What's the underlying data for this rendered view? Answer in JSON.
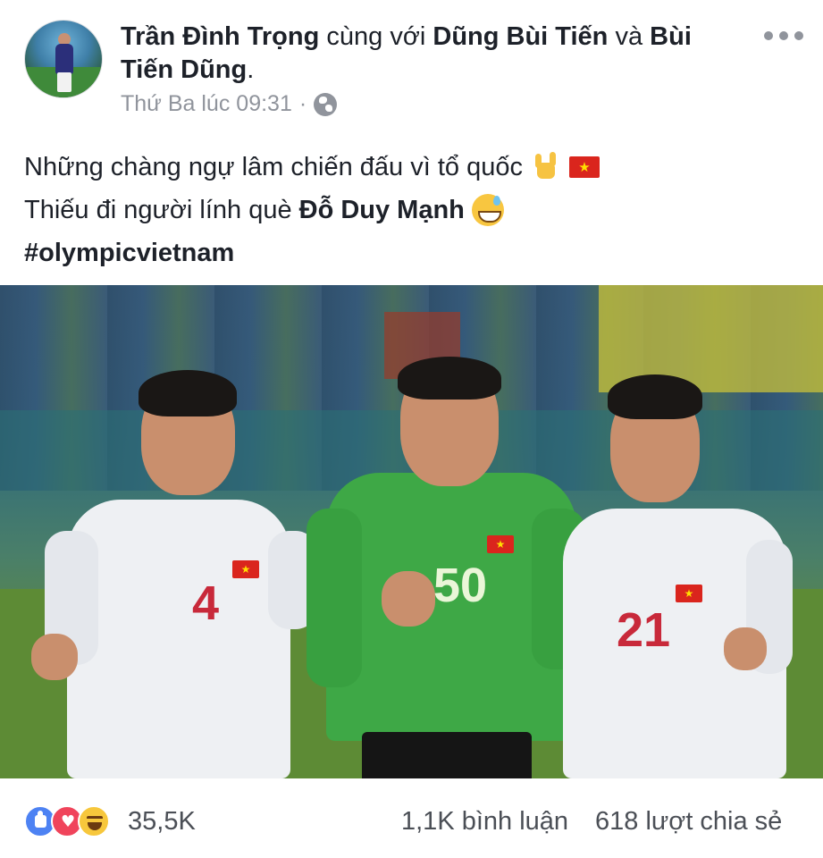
{
  "post": {
    "author": "Trần Đình Trọng",
    "with_text": "cùng với",
    "tagged_1": "Dũng Bùi Tiến",
    "and_text": "và",
    "tagged_2_line1": "Bùi",
    "tagged_2_line2": "Tiến Dũng",
    "period": ".",
    "timestamp": "Thứ Ba lúc 09:31",
    "separator": "·",
    "privacy_icon": "globe-icon",
    "more_icon": "more-options-icon"
  },
  "content": {
    "line1": "Những chàng ngự lâm chiến đấu vì tổ quốc",
    "line2_prefix": "Thiếu đi người lính què",
    "line2_bold": "Đỗ Duy Mạnh",
    "hashtag": "#olympicvietnam",
    "emoji_1": "rock-hand-emoji",
    "emoji_2": "vietnam-flag-emoji",
    "emoji_3": "grinning-sweat-emoji"
  },
  "photo": {
    "description_icon": "team-photo",
    "player_numbers": [
      "4",
      "50",
      "21"
    ]
  },
  "stats": {
    "reactions": [
      "like",
      "love",
      "haha"
    ],
    "reaction_count": "35,5K",
    "comments": "1,1K bình luận",
    "shares": "618 lượt chia sẻ"
  },
  "colors": {
    "text": "#1d2129",
    "meta": "#90949c",
    "like_blue": "#4d82f3",
    "love_red": "#f0445b",
    "haha_yellow": "#f7c73c",
    "flag_red": "#da251d",
    "flag_star": "#ffde00",
    "gk_green": "#3ea846"
  }
}
